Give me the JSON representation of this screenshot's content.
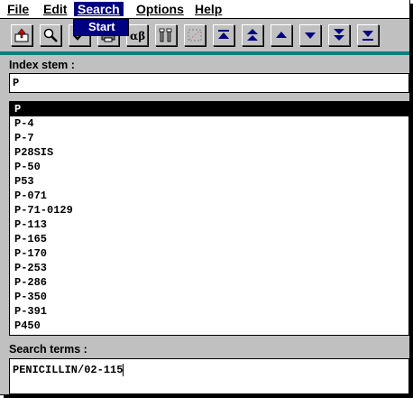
{
  "menu": {
    "items": [
      {
        "label": "File"
      },
      {
        "label": "Edit"
      },
      {
        "label": "Search"
      },
      {
        "label": "Options"
      },
      {
        "label": "Help"
      }
    ],
    "dropdown_option": "Start"
  },
  "toolbar": {
    "buttons": [
      {
        "icon": "export-icon"
      },
      {
        "icon": "magnifier-icon"
      },
      {
        "icon": "check-icon"
      },
      {
        "icon": "print-icon"
      },
      {
        "icon": "alpha-beta-icon"
      },
      {
        "icon": "tools-icon"
      },
      {
        "icon": "dotted-box-icon"
      },
      {
        "icon": "first-page-icon"
      },
      {
        "icon": "page-up-icon"
      },
      {
        "icon": "line-up-icon"
      },
      {
        "icon": "line-down-icon"
      },
      {
        "icon": "page-down-icon"
      },
      {
        "icon": "last-page-icon"
      }
    ]
  },
  "index_stem": {
    "label": "Index stem :",
    "value": "P"
  },
  "index_list": {
    "items": [
      "P",
      "P-4",
      "P-7",
      "P28SIS",
      "P-50",
      "P53",
      "P-071",
      "P-71-0129",
      "P-113",
      "P-165",
      "P-170",
      "P-253",
      "P-286",
      "P-350",
      "P-391",
      "P450"
    ],
    "selected_index": 0
  },
  "search_terms": {
    "label": "Search terms :",
    "value": "PENICILLIN/02-115"
  },
  "colors": {
    "accent_teal": "#008080",
    "menu_highlight": "#000080",
    "face": "#c0c0c0"
  }
}
